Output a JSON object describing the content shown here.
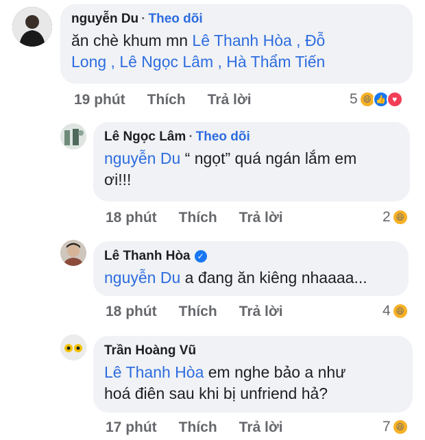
{
  "comments": [
    {
      "author": "nguyễn Du",
      "follow": "Theo dõi",
      "text_plain": "ăn chè khum mn ",
      "mentions_line1": "Lê Thanh Hòa , Đỗ",
      "mentions_line2": "Long , Lê Ngọc Lâm , Hà Thẩm Tiến",
      "time": "19 phút",
      "like": "Thích",
      "reply": "Trả lời",
      "reaction_count": "5",
      "reactions": [
        "haha-icon",
        "like-icon",
        "love-icon"
      ]
    },
    {
      "author": "Lê Ngọc Lâm",
      "follow": "Theo dõi",
      "mention": "nguyễn Du",
      "text_line1": " “ ngọt” quá ngán lắm em",
      "text_line2": "ơi!!!",
      "time": "18 phút",
      "like": "Thích",
      "reply": "Trả lời",
      "reaction_count": "2",
      "reactions": [
        "haha-icon"
      ]
    },
    {
      "author": "Lê Thanh Hòa",
      "verified": true,
      "mention": "nguyễn Du",
      "text": " a đang ăn kiêng nhaaaa...",
      "time": "18 phút",
      "like": "Thích",
      "reply": "Trả lời",
      "reaction_count": "4",
      "reactions": [
        "haha-icon"
      ]
    },
    {
      "author": "Trần Hoàng Vũ",
      "mention": "Lê Thanh Hòa",
      "text_line1": " em nghe bảo a như",
      "text_line2": "hoá điên sau khi bị unfriend hả?",
      "time": "17 phút",
      "like": "Thích",
      "reply": "Trả lời",
      "reaction_count": "7",
      "reactions": [
        "haha-icon"
      ]
    }
  ],
  "separator": "·",
  "colors": {
    "link": "#2d6cdf",
    "bubble": "#f0f2f5",
    "meta": "#65676b"
  }
}
